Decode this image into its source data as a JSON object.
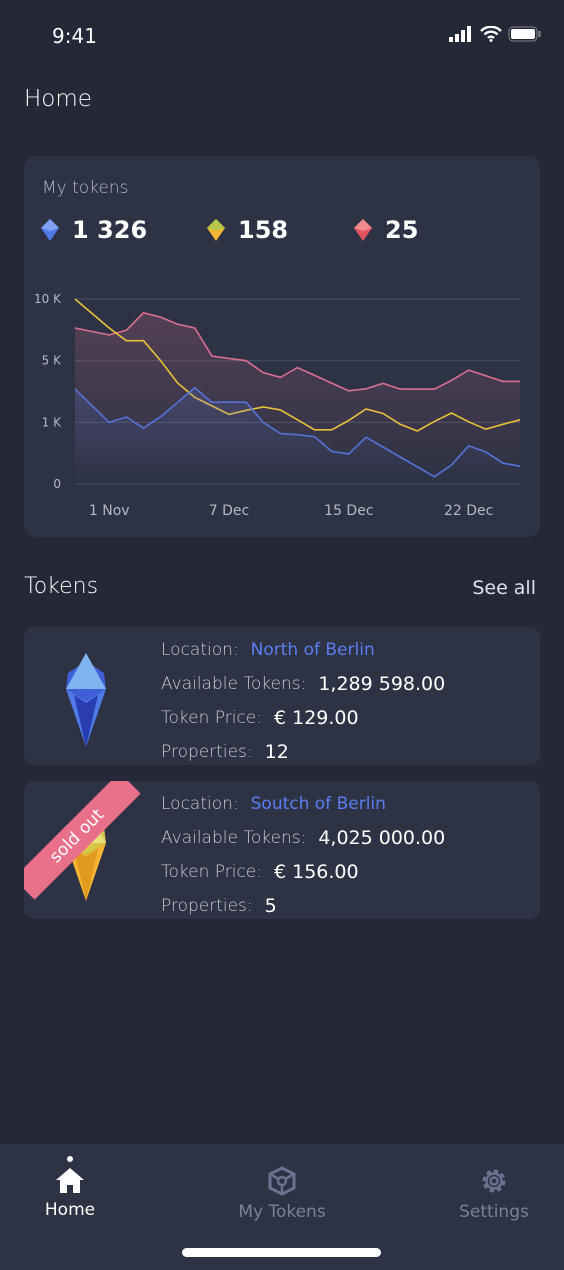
{
  "status": {
    "time": "9:41"
  },
  "header": {
    "title": "Home"
  },
  "summary": {
    "title": "My tokens",
    "balances": [
      {
        "icon": "blue-token-icon",
        "value": "1 326",
        "color": "#4f7ae8"
      },
      {
        "icon": "yellow-token-icon",
        "value": "158",
        "color": "#f5c232"
      },
      {
        "icon": "red-token-icon",
        "value": "25",
        "color": "#e0555f"
      }
    ]
  },
  "chart_data": {
    "type": "area",
    "y_scale": "nonlinear",
    "y_ticks": [
      "10 K",
      "5 K",
      "1 K",
      "0"
    ],
    "y_tick_values": [
      10000,
      5000,
      1000,
      0
    ],
    "ylim": [
      0,
      10000
    ],
    "x_ticks": [
      {
        "label": "1 Nov",
        "index": 2
      },
      {
        "label": "7 Dec",
        "index": 9
      },
      {
        "label": "15 Dec",
        "index": 16
      },
      {
        "label": "22 Dec",
        "index": 23
      }
    ],
    "grid": true,
    "series": [
      {
        "color": "#d9708f",
        "values": [
          7650,
          7370,
          7090,
          7460,
          8880,
          8530,
          7955,
          7650,
          5380,
          5190,
          5000,
          4220,
          3920,
          4550,
          4050,
          3550,
          3050,
          3180,
          3530,
          3160,
          3160,
          3160,
          3720,
          4390,
          4030,
          3660,
          3660
        ]
      },
      {
        "color": "#e8c23a",
        "values": [
          10000,
          8825,
          7650,
          6620,
          6620,
          5005,
          3550,
          2620,
          2070,
          1520,
          1785,
          2000,
          1810,
          1170,
          880,
          880,
          1130,
          1870,
          1580,
          970,
          860,
          1065,
          1610,
          1040,
          890,
          970,
          1170
        ]
      },
      {
        "color": "#5674d8",
        "values": [
          3160,
          2080,
          1000,
          1350,
          910,
          1370,
          2310,
          3250,
          2300,
          2320,
          2300,
          1000,
          820,
          800,
          770,
          530,
          490,
          760,
          600,
          440,
          280,
          120,
          310,
          620,
          520,
          340,
          290
        ]
      }
    ]
  },
  "tokens": {
    "title": "Tokens",
    "see_all": "See all",
    "items": [
      {
        "location_label": "Location:",
        "location": "North of Berlin",
        "available_label": "Available Tokens:",
        "available": "1,289 598.00",
        "price_label": "Token Price:",
        "price": "€ 129.00",
        "properties_label": "Properties:",
        "properties": "12",
        "badge": null,
        "color": "#4f7ae8"
      },
      {
        "location_label": "Location:",
        "location": "Soutch of Berlin",
        "available_label": "Available Tokens:",
        "available": "4,025 000.00",
        "price_label": "Token Price:",
        "price": "€ 156.00",
        "properties_label": "Properties:",
        "properties": "5",
        "badge": "sold out",
        "color": "#f5c232"
      }
    ]
  },
  "nav": {
    "items": [
      {
        "label": "Home",
        "icon": "home-icon",
        "active": true
      },
      {
        "label": "My Tokens",
        "icon": "cube-icon"
      },
      {
        "label": "Settings",
        "icon": "gear-icon"
      }
    ]
  }
}
